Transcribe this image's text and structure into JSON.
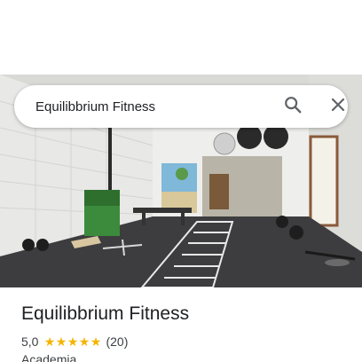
{
  "search": {
    "value": "Equilibbrium Fitness",
    "search_icon": "search-icon",
    "close_icon": "close-icon"
  },
  "place": {
    "name": "Equilibbrium Fitness",
    "rating": "5,0",
    "rating_value": 5.0,
    "stars_filled": 5,
    "reviews": "(20)",
    "category": "Academia"
  },
  "colors": {
    "star": "#f5b400",
    "text_primary": "#202124",
    "text_secondary": "#3c4043"
  }
}
